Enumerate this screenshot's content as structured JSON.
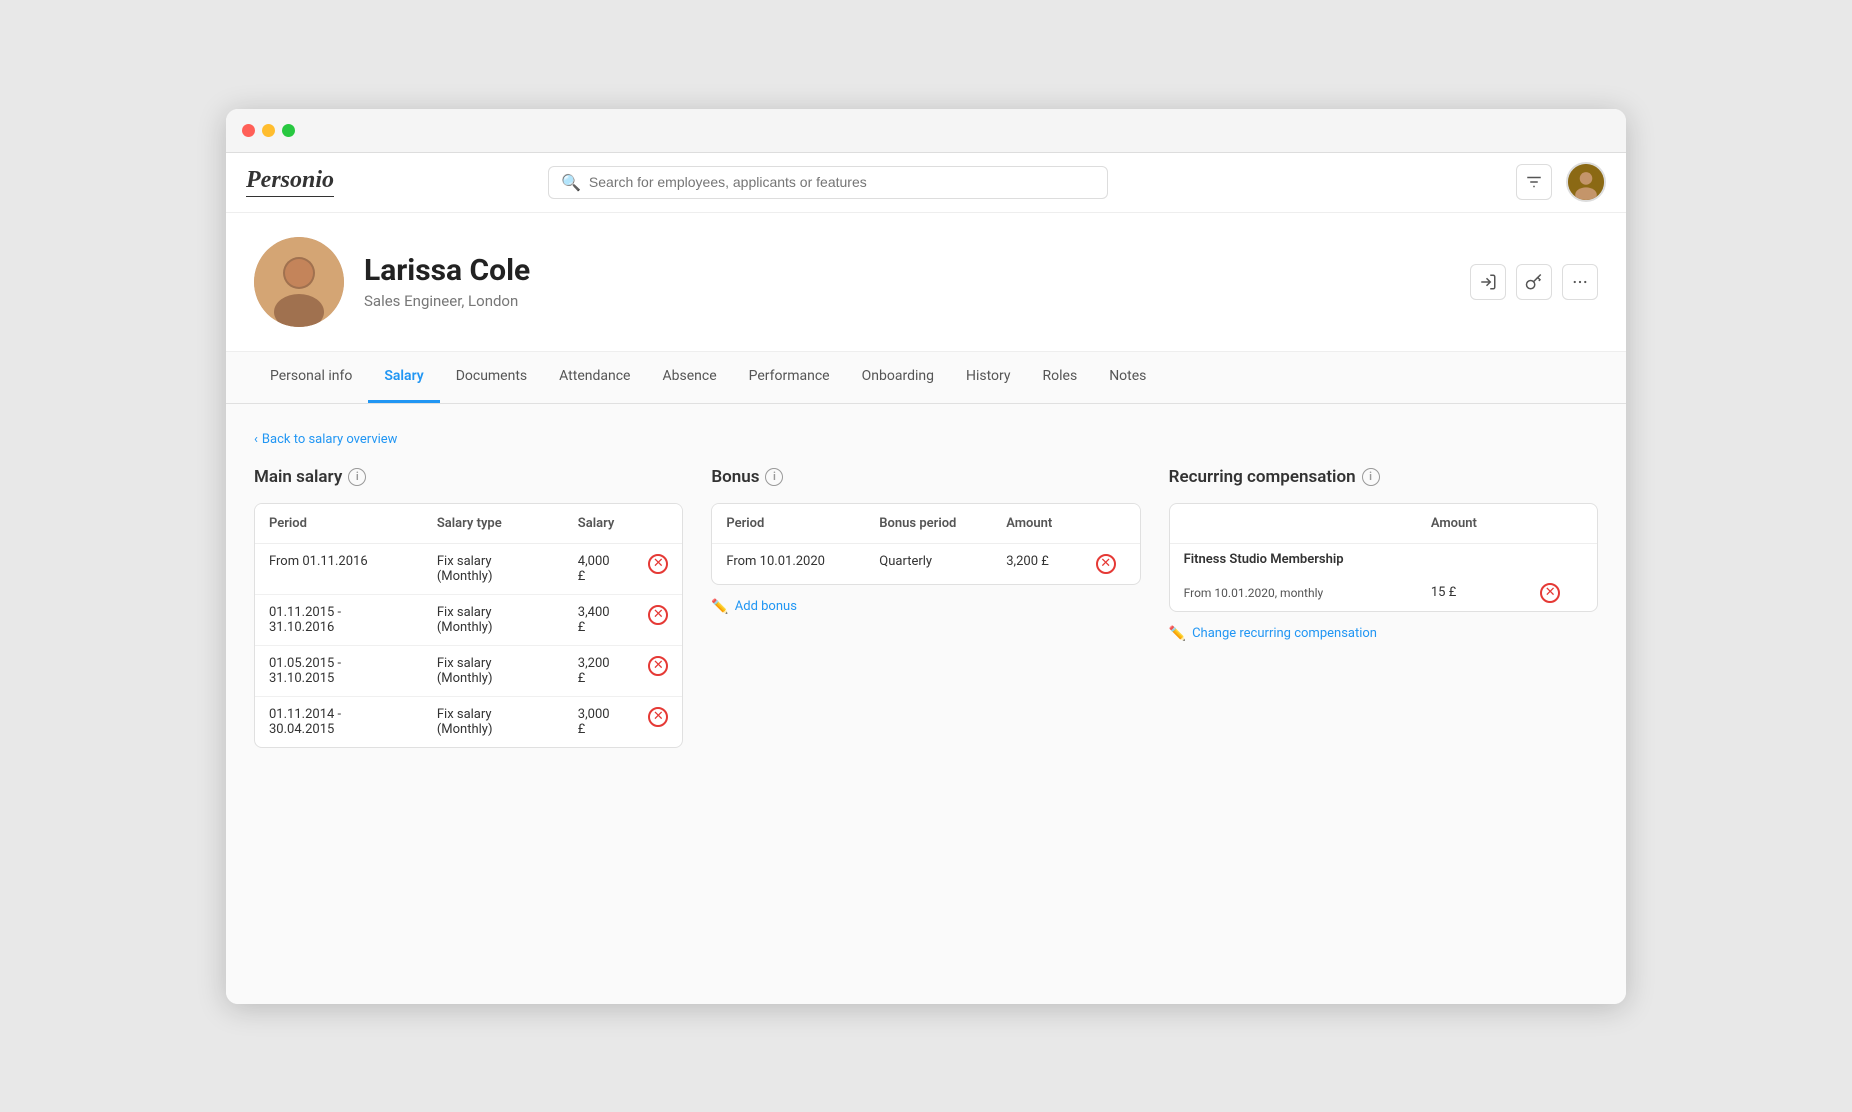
{
  "window": {
    "titlebar_dots": [
      "red",
      "yellow",
      "green"
    ]
  },
  "topnav": {
    "logo": "Personio",
    "search_placeholder": "Search for employees, applicants or features",
    "nav_icons": [
      "filter-icon",
      "user-icon"
    ]
  },
  "profile": {
    "name": "Larissa Cole",
    "role": "Sales Engineer, London",
    "actions": [
      "login-icon",
      "key-icon",
      "more-icon"
    ]
  },
  "tabs": [
    {
      "id": "personal-info",
      "label": "Personal info",
      "active": false
    },
    {
      "id": "salary",
      "label": "Salary",
      "active": true
    },
    {
      "id": "documents",
      "label": "Documents",
      "active": false
    },
    {
      "id": "attendance",
      "label": "Attendance",
      "active": false
    },
    {
      "id": "absence",
      "label": "Absence",
      "active": false
    },
    {
      "id": "performance",
      "label": "Performance",
      "active": false
    },
    {
      "id": "onboarding",
      "label": "Onboarding",
      "active": false
    },
    {
      "id": "history",
      "label": "History",
      "active": false
    },
    {
      "id": "roles",
      "label": "Roles",
      "active": false
    },
    {
      "id": "notes",
      "label": "Notes",
      "active": false
    }
  ],
  "back_link": "Back to salary overview",
  "main_salary": {
    "title": "Main salary",
    "columns": [
      "Period",
      "Salary type",
      "Salary"
    ],
    "rows": [
      {
        "period": "From 01.11.2016",
        "type": "Fix salary (Monthly)",
        "salary": "4,000 £"
      },
      {
        "period": "01.11.2015 - 31.10.2016",
        "type": "Fix salary (Monthly)",
        "salary": "3,400 £"
      },
      {
        "period": "01.05.2015 - 31.10.2015",
        "type": "Fix salary (Monthly)",
        "salary": "3,200 £"
      },
      {
        "period": "01.11.2014 - 30.04.2015",
        "type": "Fix salary (Monthly)",
        "salary": "3,000 £"
      }
    ]
  },
  "bonus": {
    "title": "Bonus",
    "columns": [
      "Period",
      "Bonus period",
      "Amount"
    ],
    "rows": [
      {
        "period": "From 10.01.2020",
        "bonus_period": "Quarterly",
        "amount": "3,200 £"
      }
    ],
    "add_label": "Add bonus"
  },
  "recurring": {
    "title": "Recurring compensation",
    "columns": [
      "",
      "Amount"
    ],
    "items": [
      {
        "name": "Fitness Studio Membership",
        "rows": [
          {
            "period": "From 10.01.2020, monthly",
            "amount": "15 £"
          }
        ]
      }
    ],
    "change_label": "Change recurring compensation"
  }
}
